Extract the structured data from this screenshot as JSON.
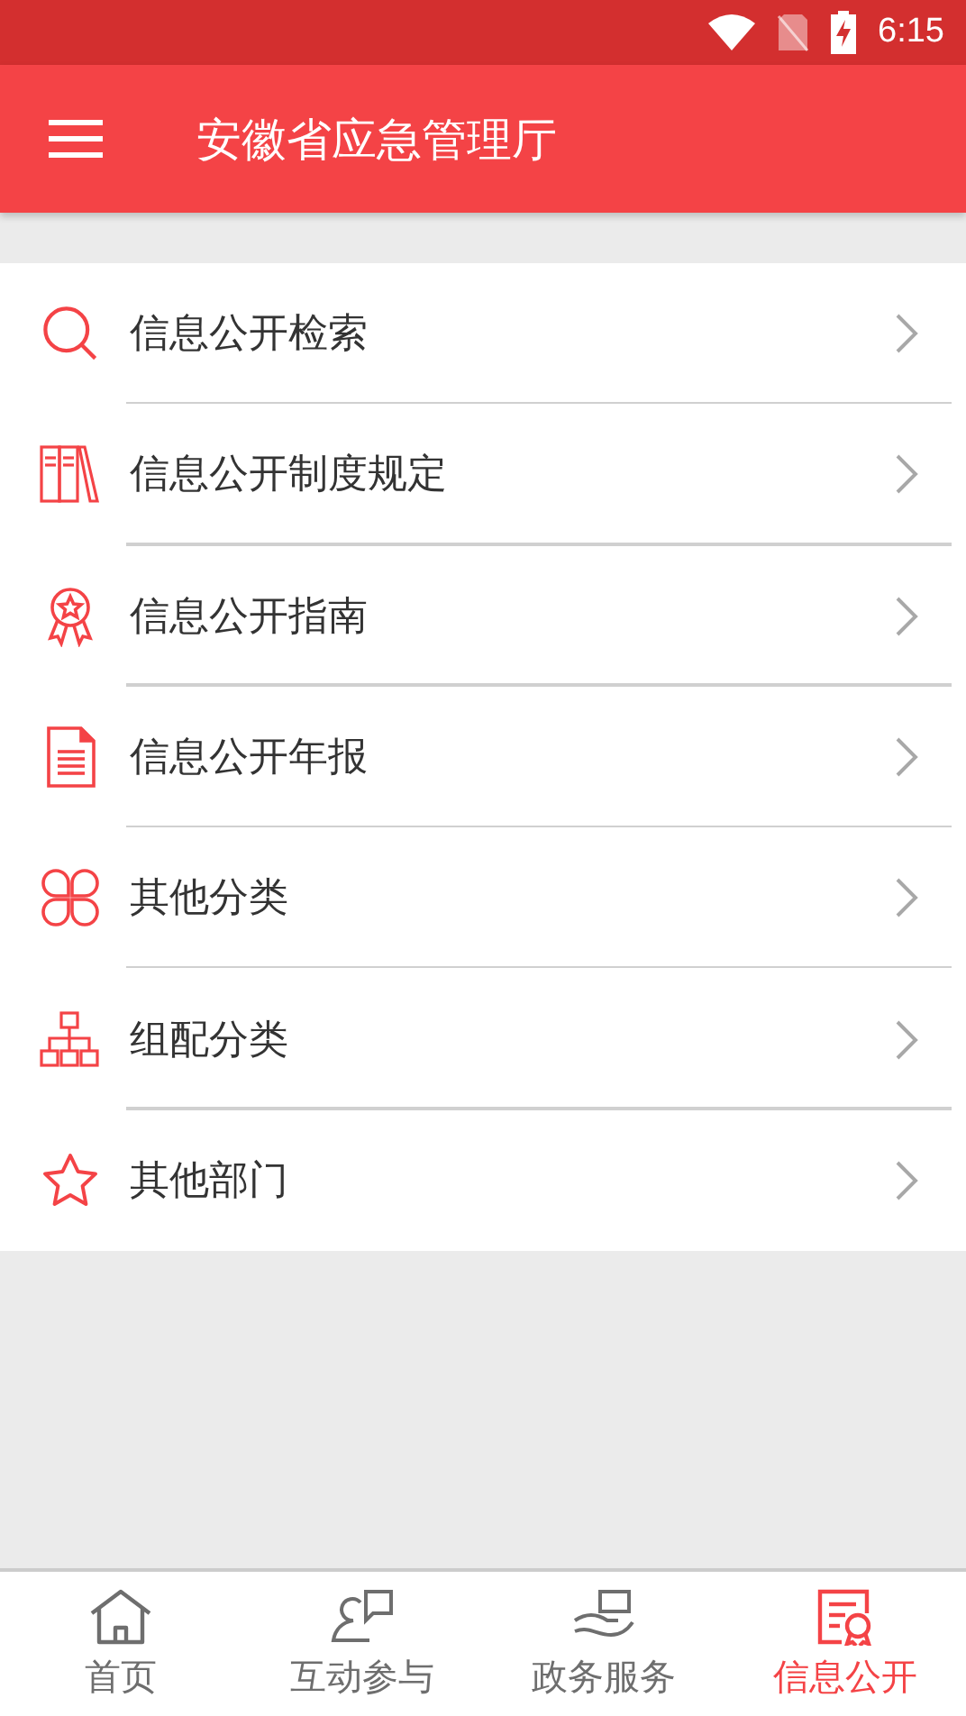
{
  "status_bar": {
    "time": "6:15"
  },
  "toolbar": {
    "title": "安徽省应急管理厅"
  },
  "menu_items": [
    {
      "kind": "search",
      "label": "信息公开检索"
    },
    {
      "kind": "books",
      "label": "信息公开制度规定"
    },
    {
      "kind": "award",
      "label": "信息公开指南"
    },
    {
      "kind": "document",
      "label": "信息公开年报"
    },
    {
      "kind": "clover",
      "label": "其他分类"
    },
    {
      "kind": "org",
      "label": "组配分类"
    },
    {
      "kind": "star",
      "label": "其他部门"
    }
  ],
  "bottom_nav": [
    {
      "kind": "home",
      "label": "首页",
      "selected": false
    },
    {
      "kind": "chat",
      "label": "互动参与",
      "selected": false
    },
    {
      "kind": "hand",
      "label": "政务服务",
      "selected": false
    },
    {
      "kind": "certificate",
      "label": "信息公开",
      "selected": true
    }
  ]
}
